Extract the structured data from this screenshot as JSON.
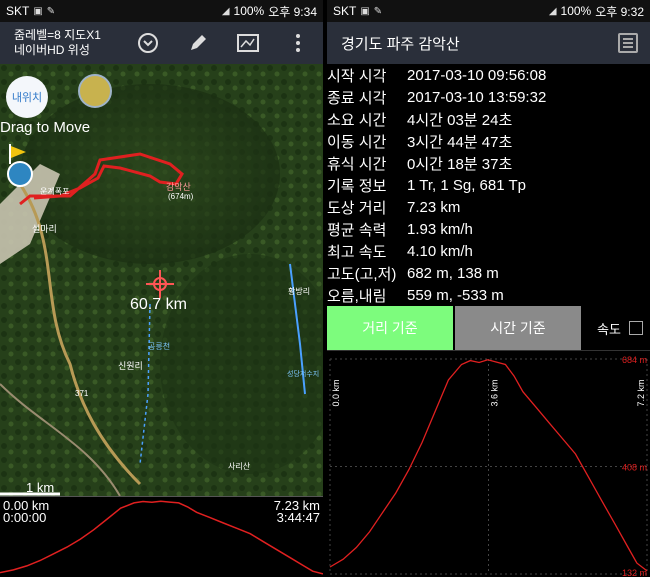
{
  "left": {
    "status": {
      "carrier": "SKT",
      "battery": "100%",
      "time": "오후 9:34"
    },
    "toolbar": {
      "line1": "줌레벨=8 지도X1",
      "line2": "네이버HD 위성"
    },
    "map": {
      "home_button": "내위치",
      "drag_hint": "Drag to Move",
      "distance": "60.7 km",
      "scale": "1 km",
      "labels": {
        "peak": "감악산",
        "peak_elev": "(674m)",
        "village": "설마리",
        "place1": "운계폭포",
        "place2": "신원리",
        "place3": "사리산",
        "place4": "황방리",
        "place5": "공릉천",
        "place6": "성당저수지",
        "road_no": "371"
      }
    },
    "elevation": {
      "start_distance": "0.00 km",
      "start_time": "0:00:00",
      "end_distance": "7.23 km",
      "end_time": "3:44:47"
    }
  },
  "right": {
    "status": {
      "carrier": "SKT",
      "battery": "100%",
      "time": "오후 9:32"
    },
    "title": "경기도 파주 감악산",
    "stats": [
      {
        "label": "시작 시각",
        "value": "2017-03-10 09:56:08"
      },
      {
        "label": "종료 시각",
        "value": "2017-03-10 13:59:32"
      },
      {
        "label": "소요 시간",
        "value": "4시간 03분 24초"
      },
      {
        "label": "이동 시간",
        "value": "3시간 44분 47초"
      },
      {
        "label": "휴식 시간",
        "value": "0시간 18분 37초"
      },
      {
        "label": "기록 정보",
        "value": "1 Tr, 1 Sg, 681 Tp"
      },
      {
        "label": "도상 거리",
        "value": "7.23 km"
      },
      {
        "label": "평균 속력",
        "value": "1.93 km/h"
      },
      {
        "label": "최고 속도",
        "value": "4.10 km/h"
      },
      {
        "label": "고도(고,저)",
        "value": "682 m, 138 m"
      },
      {
        "label": "오름,내림",
        "value": "559 m, -533 m"
      }
    ],
    "buttons": {
      "distance": "거리 기준",
      "time": "시간 기준",
      "speed": "속도"
    },
    "chart_labels": {
      "x_start": "0.0 km",
      "x_mid": "3.6 km",
      "x_end": "7.2 km",
      "y_top": "684 m",
      "y_mid": "408 m",
      "y_bottom": "132 m"
    }
  },
  "colors": {
    "accent_green": "#7dfc7d",
    "track_red": "#e02020",
    "toolbar_bg": "#2a2f3a"
  },
  "chart_data": {
    "type": "area",
    "xlabel": "",
    "ylabel": "",
    "x_ticks": [
      "0.0 km",
      "3.6 km",
      "7.2 km"
    ],
    "y_ticks": [
      "132 m",
      "408 m",
      "684 m"
    ],
    "x": [
      0.0,
      0.3,
      0.6,
      0.9,
      1.2,
      1.5,
      1.8,
      2.1,
      2.4,
      2.7,
      3.0,
      3.2,
      3.4,
      3.6,
      3.8,
      4.0,
      4.2,
      4.4,
      4.7,
      5.0,
      5.3,
      5.6,
      5.9,
      6.2,
      6.5,
      6.8,
      7.0,
      7.23
    ],
    "y": [
      150,
      170,
      200,
      240,
      290,
      340,
      400,
      470,
      550,
      630,
      670,
      680,
      675,
      682,
      676,
      670,
      640,
      600,
      560,
      520,
      480,
      440,
      380,
      320,
      260,
      200,
      160,
      140
    ],
    "ylim": [
      132,
      684
    ],
    "xlim": [
      0,
      7.23
    ],
    "grid": true
  }
}
